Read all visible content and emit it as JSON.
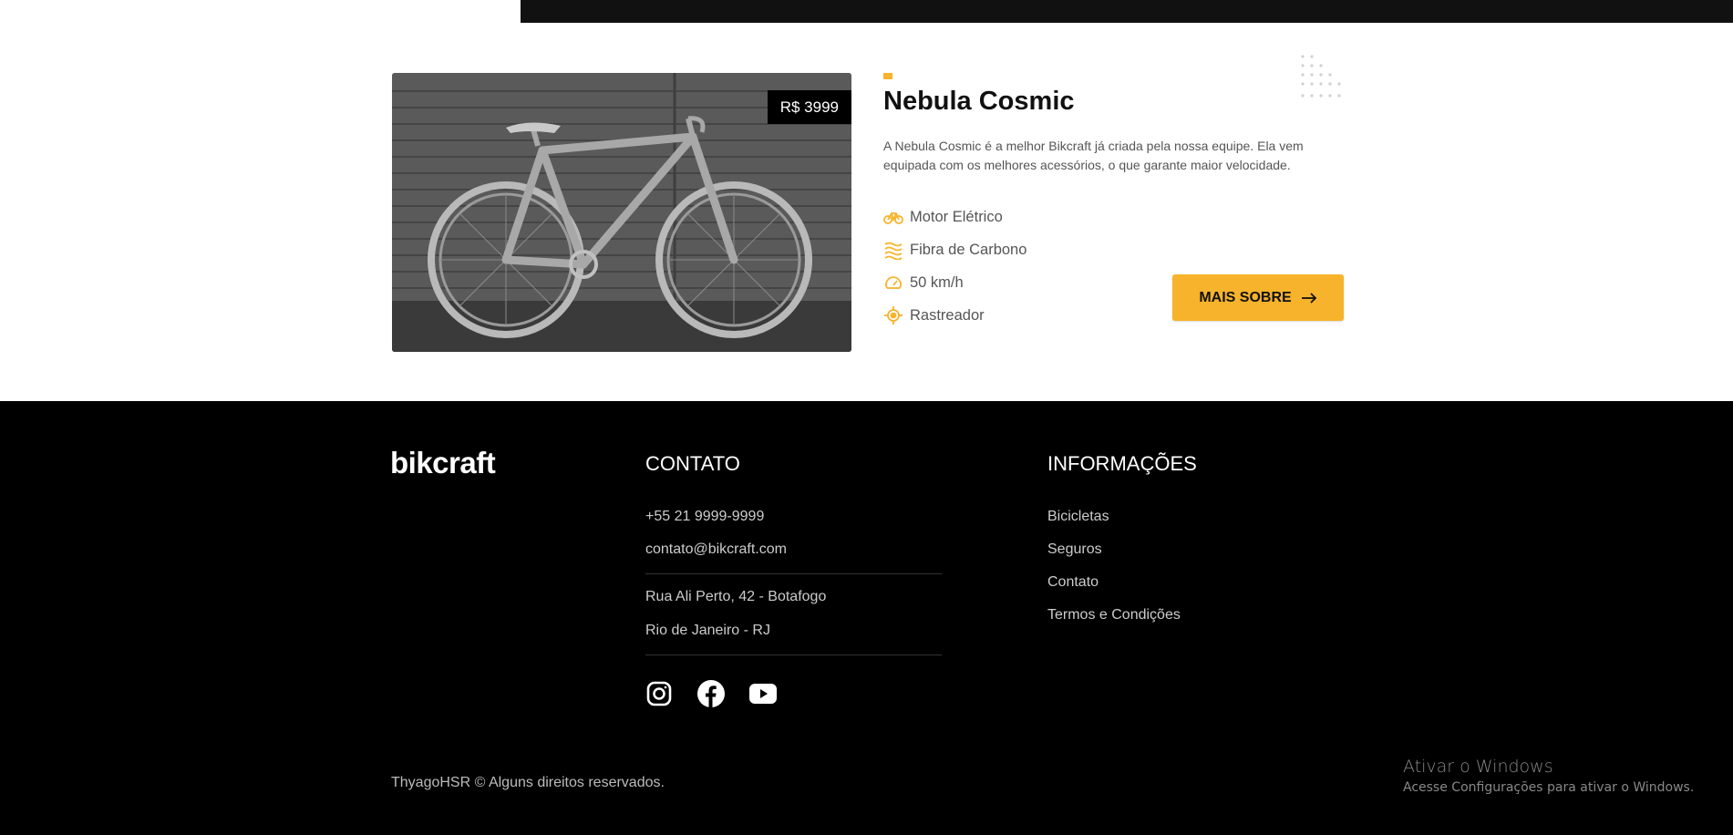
{
  "product": {
    "price": "R$ 3999",
    "name": "Nebula Cosmic",
    "description": "A Nebula Cosmic é a melhor Bikcraft já criada pela nossa equipe. Ela vem equipada com os melhores acessórios, o que garante maior velocidade.",
    "features": [
      {
        "icon": "electric-bike-icon",
        "label": "Motor Elétrico"
      },
      {
        "icon": "carbon-fiber-icon",
        "label": "Fibra de Carbono"
      },
      {
        "icon": "speedometer-icon",
        "label": "50 km/h"
      },
      {
        "icon": "tracker-icon",
        "label": "Rastreador"
      }
    ],
    "cta_label": "MAIS SOBRE",
    "accent_color": "#F7B32B"
  },
  "footer": {
    "brand": "bikcraft",
    "contact": {
      "title": "CONTATO",
      "phone": "+55 21 9999-9999",
      "email": "contato@bikcraft.com",
      "address_line1": "Rua Ali Perto, 42 - Botafogo",
      "address_line2": "Rio de Janeiro - RJ",
      "social": [
        "instagram-icon",
        "facebook-icon",
        "youtube-icon"
      ]
    },
    "info": {
      "title": "INFORMAÇÕES",
      "links": [
        "Bicicletas",
        "Seguros",
        "Contato",
        "Termos e Condições"
      ]
    },
    "copyright": "ThyagoHSR © Alguns direitos reservados."
  },
  "windows_watermark": {
    "line1": "Ativar o Windows",
    "line2": "Acesse Configurações para ativar o Windows."
  }
}
